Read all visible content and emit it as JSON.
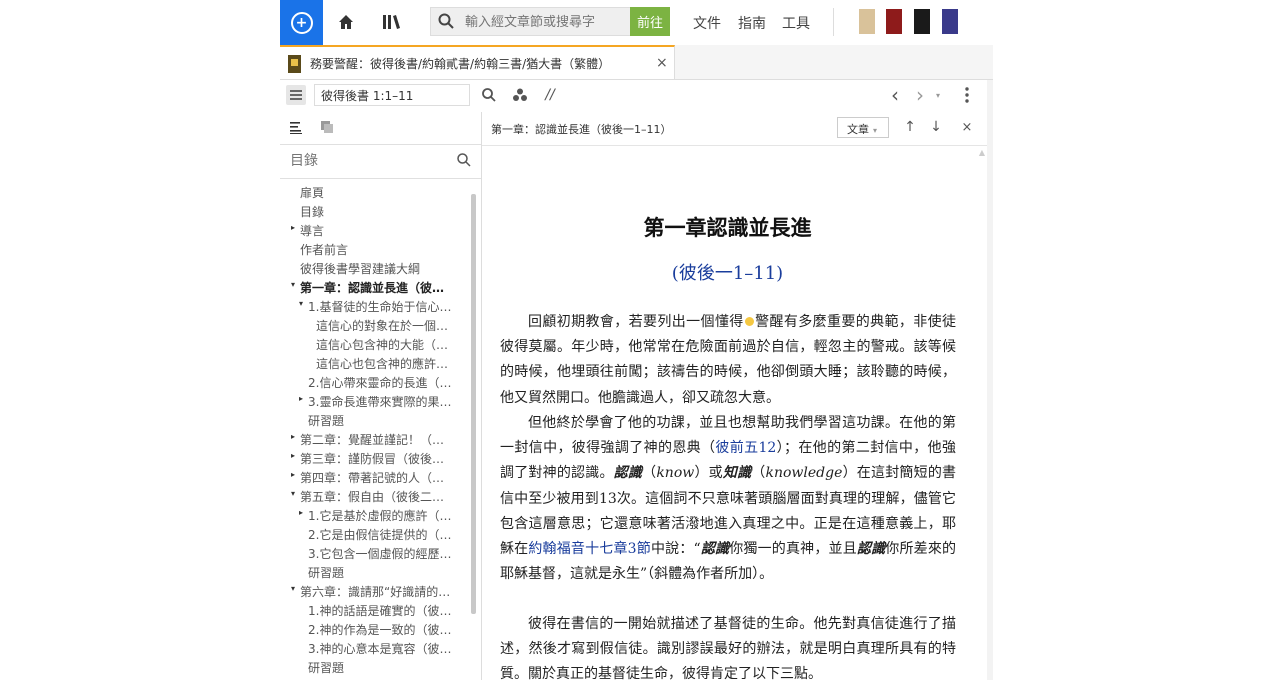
{
  "topbar": {
    "search_placeholder": "輸入經文章節或搜尋字",
    "go_label": "前往",
    "menu": [
      "文件",
      "指南",
      "工具"
    ]
  },
  "tab": {
    "title": "務要警醒：彼得後書/約翰貳書/約翰三書/猶大書（繁體）",
    "close": "×"
  },
  "toolbar": {
    "reference": "彼得後書 1:1–11",
    "parallel": "//"
  },
  "sidebar": {
    "search_placeholder": "目錄",
    "toc": [
      {
        "label": "扉頁",
        "level": 0,
        "arrow": "",
        "bold": false
      },
      {
        "label": "目錄",
        "level": 0,
        "arrow": "",
        "bold": false
      },
      {
        "label": "導言",
        "level": 0,
        "arrow": "▸",
        "bold": false
      },
      {
        "label": "作者前言",
        "level": 0,
        "arrow": "",
        "bold": false
      },
      {
        "label": "彼得後書學習建議大綱",
        "level": 0,
        "arrow": "",
        "bold": false
      },
      {
        "label": "第一章：認識並長進（彼…",
        "level": 0,
        "arrow": "▾",
        "bold": true
      },
      {
        "label": "1.基督徒的生命始于信心…",
        "level": 1,
        "arrow": "▾",
        "bold": false
      },
      {
        "label": "這信心的對象在於一個…",
        "level": 2,
        "arrow": "",
        "bold": false
      },
      {
        "label": "這信心包含神的大能（…",
        "level": 2,
        "arrow": "",
        "bold": false
      },
      {
        "label": "這信心也包含神的應許…",
        "level": 2,
        "arrow": "",
        "bold": false
      },
      {
        "label": "2.信心帶來靈命的長進（…",
        "level": 1,
        "arrow": "",
        "bold": false
      },
      {
        "label": "3.靈命長進帶來實際的果…",
        "level": 1,
        "arrow": "▸",
        "bold": false
      },
      {
        "label": "研習題",
        "level": 1,
        "arrow": "",
        "bold": false
      },
      {
        "label": "第二章：覺醒並謹記！（…",
        "level": 0,
        "arrow": "▸",
        "bold": false
      },
      {
        "label": "第三章：謹防假冒（彼後…",
        "level": 0,
        "arrow": "▸",
        "bold": false
      },
      {
        "label": "第四章：帶著記號的人（…",
        "level": 0,
        "arrow": "▸",
        "bold": false
      },
      {
        "label": "第五章：假自由（彼後二…",
        "level": 0,
        "arrow": "▾",
        "bold": false
      },
      {
        "label": "1.它是基於虛假的應許（…",
        "level": 1,
        "arrow": "▸",
        "bold": false
      },
      {
        "label": "2.它是由假信徒提供的（…",
        "level": 1,
        "arrow": "",
        "bold": false
      },
      {
        "label": "3.它包含一個虛假的經歷…",
        "level": 1,
        "arrow": "",
        "bold": false
      },
      {
        "label": "研習題",
        "level": 1,
        "arrow": "",
        "bold": false
      },
      {
        "label": "第六章：識請那“好識請的…",
        "level": 0,
        "arrow": "▾",
        "bold": false
      },
      {
        "label": "1.神的話語是確實的（彼…",
        "level": 1,
        "arrow": "",
        "bold": false
      },
      {
        "label": "2.神的作為是一致的（彼…",
        "level": 1,
        "arrow": "",
        "bold": false
      },
      {
        "label": "3.神的心意本是寬容（彼…",
        "level": 1,
        "arrow": "",
        "bold": false
      },
      {
        "label": "研習題",
        "level": 1,
        "arrow": "",
        "bold": false
      }
    ]
  },
  "content": {
    "header_title": "第一章：認識並長進（彼後一1–11）",
    "view_select": "文章",
    "heading": "第一章認識並長進",
    "subheading": "(彼後一1–11)",
    "p1": {
      "a": "回顧初期教會，若要列出一個懂得",
      "b": "警醒有多麼重要的典範，非使徒彼得莫屬。年少時，他常常在危險面前過於自信，輕忽主的警戒。該等候的時候，他埋頭往前闖；該禱告的時候，他卻倒頭大睡；該聆聽的時候，他又貿然開口。他膽識過人，卻又疏忽大意。"
    },
    "p2": {
      "a": "但他終於學會了他的功課，並且也想幫助我們學習這功課。在他的第一封信中，彼得強調了神的恩典（",
      "link1": "彼前五12",
      "b": "）；在他的第二封信中，他強調了對神的認識。",
      "em1": "認識",
      "c": "（",
      "em2": "know",
      "d": "）或",
      "em3": "知識",
      "e": "（",
      "em4": "knowledge",
      "f": "）在這封簡短的書信中至少被用到13次。這個詞不只意味著頭腦層面對真理的理解，儘管它包含這層意思；它還意味著活潑地進入真理之中。正是在這種意義上，耶穌在",
      "link2": "約翰福音十七章3節",
      "g": "中說：“",
      "em5": "認識",
      "h": "你獨一的真神，並且",
      "em6": "認識",
      "i": "你所差來的耶穌基督，這就是永生”（斜體為作者所加）。"
    },
    "p3": "彼得在書信的一開始就描述了基督徒的生命。他先對真信徒進行了描述，然後才寫到假信徒。識別謬誤最好的辦法，就是明白真理所具有的特質。關於真正的基督徒生命，彼得肯定了以下三點。"
  },
  "colors": {
    "brand_blue": "#1a73e8",
    "go_green": "#7cb342",
    "tab_accent": "#f5a623",
    "link_blue": "#1a3d9c"
  }
}
